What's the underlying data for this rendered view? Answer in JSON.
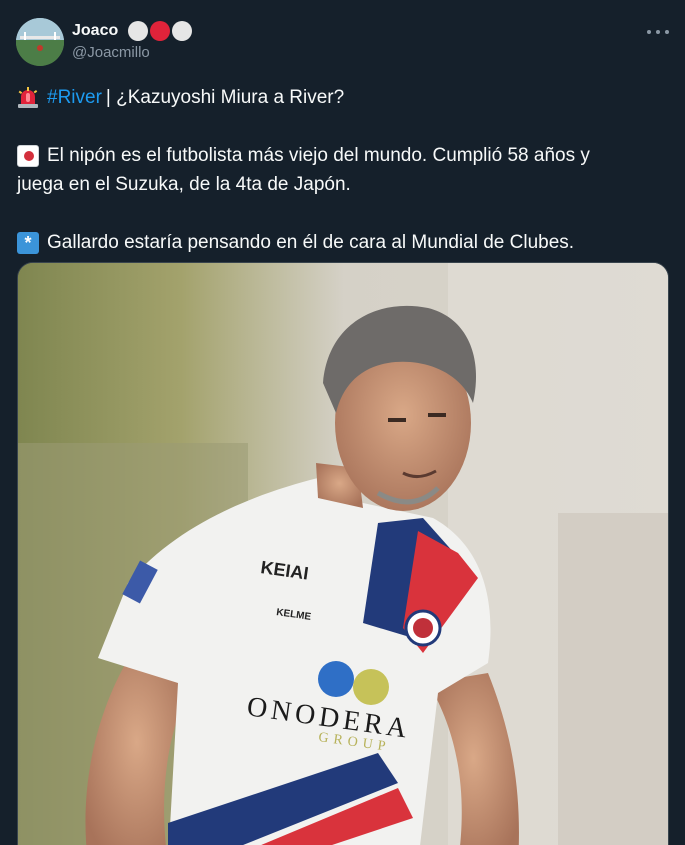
{
  "author": {
    "display_name": "Joaco",
    "handle": "@Joacmillo",
    "badge_dots": [
      "#e6e6e6",
      "#e0233a",
      "#e6e6e6"
    ]
  },
  "menu": {
    "icon": "more-horizontal-icon"
  },
  "tweet": {
    "line1_hashtag": "#River",
    "line1_text": "| ¿Kazuyoshi Miura a River?",
    "line2_text": "El nipón es el futbolista más viejo del mundo. Cumplió 58 años y",
    "line3_text": "juega en el Suzuka, de la 4ta de Japón.",
    "line4_text": "Gallardo estaría pensando en él de cara al Mundial de Clubes.",
    "emojis": [
      "siren-emoji",
      "japan-flag-emoji",
      "asterisk-emoji"
    ]
  },
  "media": {
    "jersey_sponsor": "KEIAI",
    "jersey_brand": "KELME",
    "jersey_front": "ONODERA",
    "jersey_front_sub": "GROUP"
  },
  "colors": {
    "background": "#15202b",
    "text": "#f7f9f9",
    "secondary": "#8b98a5",
    "link": "#1d9bf0"
  }
}
